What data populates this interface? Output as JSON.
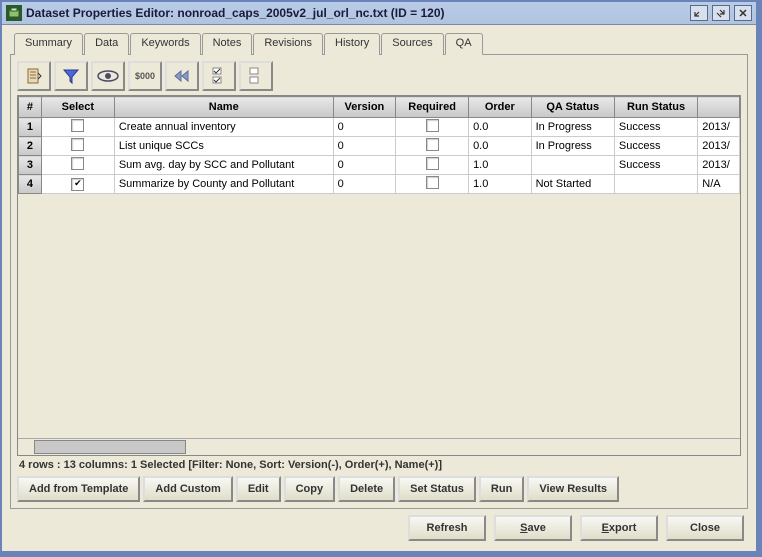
{
  "window": {
    "title": "Dataset Properties Editor: nonroad_caps_2005v2_jul_orl_nc.txt (ID = 120)"
  },
  "tabs": {
    "items": [
      "Summary",
      "Data",
      "Keywords",
      "Notes",
      "Revisions",
      "History",
      "Sources",
      "QA"
    ],
    "active": "QA"
  },
  "columns": {
    "num": "#",
    "select": "Select",
    "name": "Name",
    "version": "Version",
    "required": "Required",
    "order": "Order",
    "qa_status": "QA Status",
    "run_status": "Run Status",
    "extra": ""
  },
  "rows": [
    {
      "num": "1",
      "select": false,
      "name": "Create annual inventory",
      "version": "0",
      "required": false,
      "order": "0.0",
      "qa_status": "In Progress",
      "run_status": "Success",
      "extra": "2013/"
    },
    {
      "num": "2",
      "select": false,
      "name": "List unique SCCs",
      "version": "0",
      "required": false,
      "order": "0.0",
      "qa_status": "In Progress",
      "run_status": "Success",
      "extra": "2013/"
    },
    {
      "num": "3",
      "select": false,
      "name": "Sum avg. day by SCC and Pollutant",
      "version": "0",
      "required": false,
      "order": "1.0",
      "qa_status": "",
      "run_status": "Success",
      "extra": "2013/"
    },
    {
      "num": "4",
      "select": true,
      "name": "Summarize by County and Pollutant",
      "version": "0",
      "required": false,
      "order": "1.0",
      "qa_status": "Not Started",
      "run_status": "",
      "extra": "N/A"
    }
  ],
  "status": "4 rows : 13 columns: 1 Selected [Filter: None, Sort: Version(-), Order(+), Name(+)]",
  "buttons": {
    "addTemplate": "Add from Template",
    "addCustom": "Add Custom",
    "edit": "Edit",
    "copy": "Copy",
    "delete": "Delete",
    "setStatus": "Set Status",
    "run": "Run",
    "viewResults": "View Results",
    "refresh": "Refresh",
    "save": "Save",
    "export": "Export",
    "close": "Close"
  },
  "toolbar_labels": {
    "money": "$000"
  }
}
